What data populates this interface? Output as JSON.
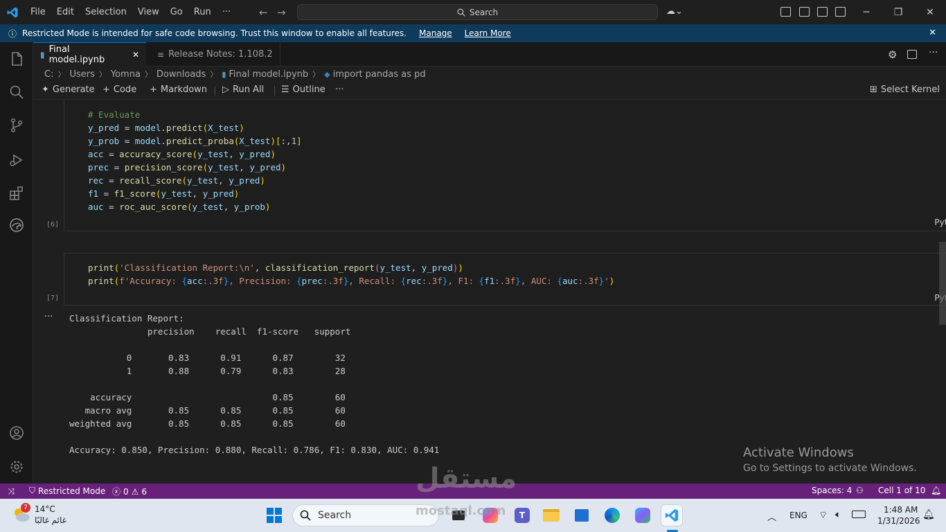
{
  "titlebar": {
    "menu": [
      "File",
      "Edit",
      "Selection",
      "View",
      "Go",
      "Run",
      "···"
    ],
    "search_placeholder": "Search"
  },
  "banner": {
    "message": "Restricted Mode is intended for safe code browsing. Trust this window to enable all features.",
    "manage": "Manage",
    "learn_more": "Learn More"
  },
  "tabs": [
    {
      "label": "Final model.ipynb",
      "active": true
    },
    {
      "label": "Release Notes: 1.108.2",
      "active": false
    }
  ],
  "breadcrumb": [
    "C:",
    "Users",
    "Yomna",
    "Downloads",
    "Final model.ipynb",
    "import pandas as pd"
  ],
  "toolbar": {
    "generate": "Generate",
    "code": "Code",
    "markdown": "Markdown",
    "run_all": "Run All",
    "outline": "Outline",
    "more": "···",
    "select_kernel": "Select Kernel"
  },
  "cells": [
    {
      "execution_count": "[6]",
      "language": "Python",
      "lines": [
        "# Evaluate",
        "y_pred = model.predict(X_test)",
        "y_prob = model.predict_proba(X_test)[:,1]",
        "acc = accuracy_score(y_test, y_pred)",
        "prec = precision_score(y_test, y_pred)",
        "rec = recall_score(y_test, y_pred)",
        "f1 = f1_score(y_test, y_pred)",
        "auc = roc_auc_score(y_test, y_prob)"
      ]
    },
    {
      "execution_count": "[7]",
      "language": "Python",
      "lines": [
        "print('Classification Report:\\n', classification_report(y_test, y_pred))",
        "print(f'Accuracy: {acc:.3f}, Precision: {prec:.3f}, Recall: {rec:.3f}, F1: {f1:.3f}, AUC: {auc:.3f}')"
      ]
    }
  ],
  "output": {
    "more": "···",
    "lines": [
      "Classification Report:",
      "               precision    recall  f1-score   support",
      "",
      "           0       0.83      0.91      0.87        32",
      "           1       0.88      0.79      0.83        28",
      "",
      "    accuracy                           0.85        60",
      "   macro avg       0.85      0.85      0.85        60",
      "weighted avg       0.85      0.85      0.85        60",
      "",
      "Accuracy: 0.850, Precision: 0.880, Recall: 0.786, F1: 0.830, AUC: 0.941"
    ]
  },
  "activate_windows": {
    "title": "Activate Windows",
    "subtitle": "Go to Settings to activate Windows."
  },
  "statusbar": {
    "restricted": "Restricted Mode",
    "errors": "0",
    "warnings": "6",
    "spaces": "Spaces: 4",
    "cell": "Cell 1 of 10"
  },
  "taskbar": {
    "weather_temp": "14°C",
    "weather_desc": "غائم غالبًا",
    "weather_badge": "7",
    "search": "Search",
    "lang": "ENG",
    "time": "1:48 AM",
    "date": "1/31/2026"
  },
  "watermark": {
    "text": "مستقل",
    "sub": "mostaql.com"
  },
  "colors": {
    "statusbar": "#68217a",
    "banner": "#0e3a5b",
    "accent": "#0078d4"
  }
}
